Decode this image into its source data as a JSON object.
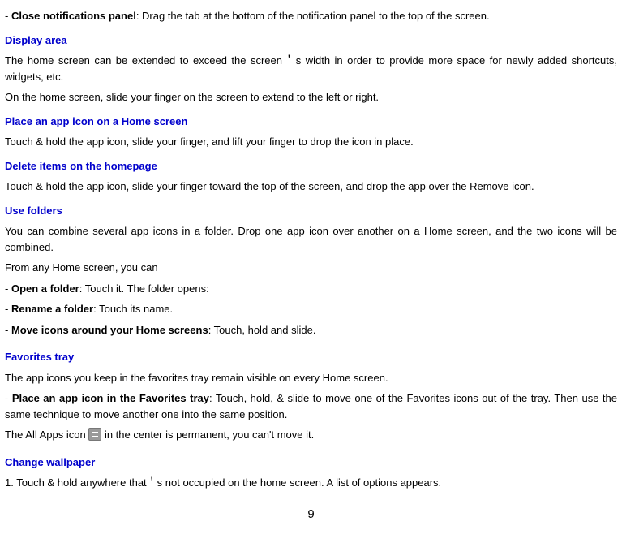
{
  "line1_prefix": "- ",
  "line1_bold": "Close notifications panel",
  "line1_rest": ": Drag the tab at the bottom of the notification panel to the top of the screen.",
  "h_display_area": "Display area",
  "p_display_area": "The home screen can be extended to exceed the screen＇s width in order to provide more space for newly added shortcuts, widgets, etc.",
  "p_display_slide": "On the home screen, slide your finger on the screen to extend to the left or right.",
  "h_place_icon": "Place an app icon on a Home screen",
  "p_place_icon": "Touch & hold the app icon, slide your finger, and lift your finger to drop the icon in place.",
  "h_delete_items": "Delete items on the homepage",
  "p_delete_items": "Touch & hold the app icon, slide your finger toward the top of the screen, and drop the app over the Remove icon.",
  "h_use_folders": "Use folders",
  "p_use_folders": "You can combine several app icons in a folder. Drop one app icon over another on a Home screen, and the two icons will be combined.",
  "p_from_any": "From any Home screen, you can",
  "open_folder_bold": "Open a folder",
  "open_folder_rest": ": Touch it. The folder opens:",
  "rename_folder_bold": "Rename a folder",
  "rename_folder_rest": ": Touch its name.",
  "move_icons_bold": "Move icons around your Home screens",
  "move_icons_rest": ": Touch, hold and slide.",
  "h_favorites": "Favorites tray",
  "p_favorites": "The app icons you keep in the favorites tray remain visible on every Home screen.",
  "fav_place_prefix": "- ",
  "fav_place_bold": "Place an app icon in the Favorites tray",
  "fav_place_rest": ": Touch, hold, & slide to move one of the Favorites icons out of the tray. Then use the same technique to move another one into the same position.",
  "all_apps_pre": "The All Apps icon ",
  "all_apps_post": " in the center is permanent, you can't move it.",
  "h_wallpaper": "Change wallpaper",
  "p_wallpaper": "1. Touch & hold anywhere that＇s not occupied on the home screen. A list of options appears.",
  "page_number": "9"
}
